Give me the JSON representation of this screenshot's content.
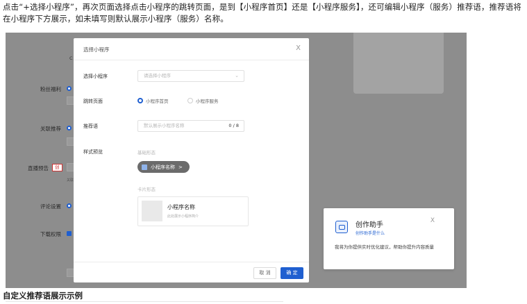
{
  "intro": "点击“+选择小程序”，再次页面选择点击小程序的跳转页面，是到【小程序首页】还是【小程序服务】，还可编辑小程序（服务）推荐语，推荐语将在小程序下方展示，如未填写则默认展示小程序（服务）名称。",
  "background": {
    "labels": [
      "粉丝福利",
      "关联推荐",
      "直播预告",
      "评论设置",
      "下载权限"
    ],
    "red_badge": "创",
    "mini_text": "关联",
    "c1": "C"
  },
  "modal": {
    "title": "选择小程序",
    "close": "X",
    "rows": {
      "select_label": "选择小程序",
      "select_placeholder": "请选择小程序",
      "jump_label": "跳转页面",
      "jump_options": [
        "小程序首页",
        "小程序服务"
      ],
      "jump_selected": "小程序首页",
      "rec_label": "推荐语",
      "rec_placeholder": "默认展示小程序名称",
      "rec_count": "0 / 8",
      "style_label": "样式预览",
      "basic_label": "基础形态",
      "pill_text": "小程序名称",
      "card_label": "卡片形态",
      "card_name": "小程序名称",
      "card_desc": "此处展示小程序简介"
    },
    "buttons": {
      "cancel": "取 消",
      "ok": "确 定"
    }
  },
  "assistant": {
    "title": "创作助手",
    "link": "创作助手是什么",
    "close": "X",
    "body": "我将为你提供实时优化建议，帮助你提升内容质量"
  },
  "caption": "自定义推荐语展示示例",
  "colors": {
    "accent": "#1f5fd0",
    "overlay": "#8d8d8d"
  }
}
